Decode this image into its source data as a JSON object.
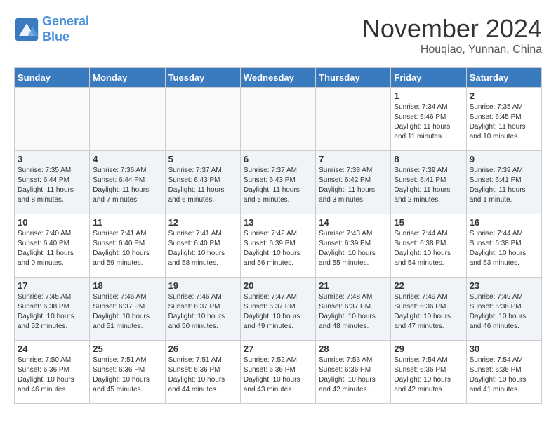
{
  "header": {
    "logo_line1": "General",
    "logo_line2": "Blue",
    "month_title": "November 2024",
    "location": "Houqiao, Yunnan, China"
  },
  "days_of_week": [
    "Sunday",
    "Monday",
    "Tuesday",
    "Wednesday",
    "Thursday",
    "Friday",
    "Saturday"
  ],
  "weeks": [
    [
      {
        "day": "",
        "info": ""
      },
      {
        "day": "",
        "info": ""
      },
      {
        "day": "",
        "info": ""
      },
      {
        "day": "",
        "info": ""
      },
      {
        "day": "",
        "info": ""
      },
      {
        "day": "1",
        "info": "Sunrise: 7:34 AM\nSunset: 6:46 PM\nDaylight: 11 hours and 11 minutes."
      },
      {
        "day": "2",
        "info": "Sunrise: 7:35 AM\nSunset: 6:45 PM\nDaylight: 11 hours and 10 minutes."
      }
    ],
    [
      {
        "day": "3",
        "info": "Sunrise: 7:35 AM\nSunset: 6:44 PM\nDaylight: 11 hours and 8 minutes."
      },
      {
        "day": "4",
        "info": "Sunrise: 7:36 AM\nSunset: 6:44 PM\nDaylight: 11 hours and 7 minutes."
      },
      {
        "day": "5",
        "info": "Sunrise: 7:37 AM\nSunset: 6:43 PM\nDaylight: 11 hours and 6 minutes."
      },
      {
        "day": "6",
        "info": "Sunrise: 7:37 AM\nSunset: 6:43 PM\nDaylight: 11 hours and 5 minutes."
      },
      {
        "day": "7",
        "info": "Sunrise: 7:38 AM\nSunset: 6:42 PM\nDaylight: 11 hours and 3 minutes."
      },
      {
        "day": "8",
        "info": "Sunrise: 7:39 AM\nSunset: 6:41 PM\nDaylight: 11 hours and 2 minutes."
      },
      {
        "day": "9",
        "info": "Sunrise: 7:39 AM\nSunset: 6:41 PM\nDaylight: 11 hours and 1 minute."
      }
    ],
    [
      {
        "day": "10",
        "info": "Sunrise: 7:40 AM\nSunset: 6:40 PM\nDaylight: 11 hours and 0 minutes."
      },
      {
        "day": "11",
        "info": "Sunrise: 7:41 AM\nSunset: 6:40 PM\nDaylight: 10 hours and 59 minutes."
      },
      {
        "day": "12",
        "info": "Sunrise: 7:41 AM\nSunset: 6:40 PM\nDaylight: 10 hours and 58 minutes."
      },
      {
        "day": "13",
        "info": "Sunrise: 7:42 AM\nSunset: 6:39 PM\nDaylight: 10 hours and 56 minutes."
      },
      {
        "day": "14",
        "info": "Sunrise: 7:43 AM\nSunset: 6:39 PM\nDaylight: 10 hours and 55 minutes."
      },
      {
        "day": "15",
        "info": "Sunrise: 7:44 AM\nSunset: 6:38 PM\nDaylight: 10 hours and 54 minutes."
      },
      {
        "day": "16",
        "info": "Sunrise: 7:44 AM\nSunset: 6:38 PM\nDaylight: 10 hours and 53 minutes."
      }
    ],
    [
      {
        "day": "17",
        "info": "Sunrise: 7:45 AM\nSunset: 6:38 PM\nDaylight: 10 hours and 52 minutes."
      },
      {
        "day": "18",
        "info": "Sunrise: 7:46 AM\nSunset: 6:37 PM\nDaylight: 10 hours and 51 minutes."
      },
      {
        "day": "19",
        "info": "Sunrise: 7:46 AM\nSunset: 6:37 PM\nDaylight: 10 hours and 50 minutes."
      },
      {
        "day": "20",
        "info": "Sunrise: 7:47 AM\nSunset: 6:37 PM\nDaylight: 10 hours and 49 minutes."
      },
      {
        "day": "21",
        "info": "Sunrise: 7:48 AM\nSunset: 6:37 PM\nDaylight: 10 hours and 48 minutes."
      },
      {
        "day": "22",
        "info": "Sunrise: 7:49 AM\nSunset: 6:36 PM\nDaylight: 10 hours and 47 minutes."
      },
      {
        "day": "23",
        "info": "Sunrise: 7:49 AM\nSunset: 6:36 PM\nDaylight: 10 hours and 46 minutes."
      }
    ],
    [
      {
        "day": "24",
        "info": "Sunrise: 7:50 AM\nSunset: 6:36 PM\nDaylight: 10 hours and 46 minutes."
      },
      {
        "day": "25",
        "info": "Sunrise: 7:51 AM\nSunset: 6:36 PM\nDaylight: 10 hours and 45 minutes."
      },
      {
        "day": "26",
        "info": "Sunrise: 7:51 AM\nSunset: 6:36 PM\nDaylight: 10 hours and 44 minutes."
      },
      {
        "day": "27",
        "info": "Sunrise: 7:52 AM\nSunset: 6:36 PM\nDaylight: 10 hours and 43 minutes."
      },
      {
        "day": "28",
        "info": "Sunrise: 7:53 AM\nSunset: 6:36 PM\nDaylight: 10 hours and 42 minutes."
      },
      {
        "day": "29",
        "info": "Sunrise: 7:54 AM\nSunset: 6:36 PM\nDaylight: 10 hours and 42 minutes."
      },
      {
        "day": "30",
        "info": "Sunrise: 7:54 AM\nSunset: 6:36 PM\nDaylight: 10 hours and 41 minutes."
      }
    ]
  ]
}
